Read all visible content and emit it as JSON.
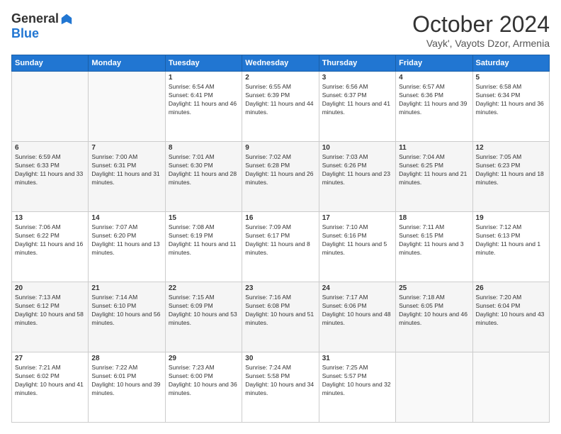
{
  "header": {
    "logo_general": "General",
    "logo_blue": "Blue",
    "month_title": "October 2024",
    "subtitle": "Vayk', Vayots Dzor, Armenia"
  },
  "days_of_week": [
    "Sunday",
    "Monday",
    "Tuesday",
    "Wednesday",
    "Thursday",
    "Friday",
    "Saturday"
  ],
  "weeks": [
    [
      {
        "day": "",
        "sunrise": "",
        "sunset": "",
        "daylight": "",
        "empty": true
      },
      {
        "day": "",
        "sunrise": "",
        "sunset": "",
        "daylight": "",
        "empty": true
      },
      {
        "day": "1",
        "sunrise": "Sunrise: 6:54 AM",
        "sunset": "Sunset: 6:41 PM",
        "daylight": "Daylight: 11 hours and 46 minutes."
      },
      {
        "day": "2",
        "sunrise": "Sunrise: 6:55 AM",
        "sunset": "Sunset: 6:39 PM",
        "daylight": "Daylight: 11 hours and 44 minutes."
      },
      {
        "day": "3",
        "sunrise": "Sunrise: 6:56 AM",
        "sunset": "Sunset: 6:37 PM",
        "daylight": "Daylight: 11 hours and 41 minutes."
      },
      {
        "day": "4",
        "sunrise": "Sunrise: 6:57 AM",
        "sunset": "Sunset: 6:36 PM",
        "daylight": "Daylight: 11 hours and 39 minutes."
      },
      {
        "day": "5",
        "sunrise": "Sunrise: 6:58 AM",
        "sunset": "Sunset: 6:34 PM",
        "daylight": "Daylight: 11 hours and 36 minutes."
      }
    ],
    [
      {
        "day": "6",
        "sunrise": "Sunrise: 6:59 AM",
        "sunset": "Sunset: 6:33 PM",
        "daylight": "Daylight: 11 hours and 33 minutes."
      },
      {
        "day": "7",
        "sunrise": "Sunrise: 7:00 AM",
        "sunset": "Sunset: 6:31 PM",
        "daylight": "Daylight: 11 hours and 31 minutes."
      },
      {
        "day": "8",
        "sunrise": "Sunrise: 7:01 AM",
        "sunset": "Sunset: 6:30 PM",
        "daylight": "Daylight: 11 hours and 28 minutes."
      },
      {
        "day": "9",
        "sunrise": "Sunrise: 7:02 AM",
        "sunset": "Sunset: 6:28 PM",
        "daylight": "Daylight: 11 hours and 26 minutes."
      },
      {
        "day": "10",
        "sunrise": "Sunrise: 7:03 AM",
        "sunset": "Sunset: 6:26 PM",
        "daylight": "Daylight: 11 hours and 23 minutes."
      },
      {
        "day": "11",
        "sunrise": "Sunrise: 7:04 AM",
        "sunset": "Sunset: 6:25 PM",
        "daylight": "Daylight: 11 hours and 21 minutes."
      },
      {
        "day": "12",
        "sunrise": "Sunrise: 7:05 AM",
        "sunset": "Sunset: 6:23 PM",
        "daylight": "Daylight: 11 hours and 18 minutes."
      }
    ],
    [
      {
        "day": "13",
        "sunrise": "Sunrise: 7:06 AM",
        "sunset": "Sunset: 6:22 PM",
        "daylight": "Daylight: 11 hours and 16 minutes."
      },
      {
        "day": "14",
        "sunrise": "Sunrise: 7:07 AM",
        "sunset": "Sunset: 6:20 PM",
        "daylight": "Daylight: 11 hours and 13 minutes."
      },
      {
        "day": "15",
        "sunrise": "Sunrise: 7:08 AM",
        "sunset": "Sunset: 6:19 PM",
        "daylight": "Daylight: 11 hours and 11 minutes."
      },
      {
        "day": "16",
        "sunrise": "Sunrise: 7:09 AM",
        "sunset": "Sunset: 6:17 PM",
        "daylight": "Daylight: 11 hours and 8 minutes."
      },
      {
        "day": "17",
        "sunrise": "Sunrise: 7:10 AM",
        "sunset": "Sunset: 6:16 PM",
        "daylight": "Daylight: 11 hours and 5 minutes."
      },
      {
        "day": "18",
        "sunrise": "Sunrise: 7:11 AM",
        "sunset": "Sunset: 6:15 PM",
        "daylight": "Daylight: 11 hours and 3 minutes."
      },
      {
        "day": "19",
        "sunrise": "Sunrise: 7:12 AM",
        "sunset": "Sunset: 6:13 PM",
        "daylight": "Daylight: 11 hours and 1 minute."
      }
    ],
    [
      {
        "day": "20",
        "sunrise": "Sunrise: 7:13 AM",
        "sunset": "Sunset: 6:12 PM",
        "daylight": "Daylight: 10 hours and 58 minutes."
      },
      {
        "day": "21",
        "sunrise": "Sunrise: 7:14 AM",
        "sunset": "Sunset: 6:10 PM",
        "daylight": "Daylight: 10 hours and 56 minutes."
      },
      {
        "day": "22",
        "sunrise": "Sunrise: 7:15 AM",
        "sunset": "Sunset: 6:09 PM",
        "daylight": "Daylight: 10 hours and 53 minutes."
      },
      {
        "day": "23",
        "sunrise": "Sunrise: 7:16 AM",
        "sunset": "Sunset: 6:08 PM",
        "daylight": "Daylight: 10 hours and 51 minutes."
      },
      {
        "day": "24",
        "sunrise": "Sunrise: 7:17 AM",
        "sunset": "Sunset: 6:06 PM",
        "daylight": "Daylight: 10 hours and 48 minutes."
      },
      {
        "day": "25",
        "sunrise": "Sunrise: 7:18 AM",
        "sunset": "Sunset: 6:05 PM",
        "daylight": "Daylight: 10 hours and 46 minutes."
      },
      {
        "day": "26",
        "sunrise": "Sunrise: 7:20 AM",
        "sunset": "Sunset: 6:04 PM",
        "daylight": "Daylight: 10 hours and 43 minutes."
      }
    ],
    [
      {
        "day": "27",
        "sunrise": "Sunrise: 7:21 AM",
        "sunset": "Sunset: 6:02 PM",
        "daylight": "Daylight: 10 hours and 41 minutes."
      },
      {
        "day": "28",
        "sunrise": "Sunrise: 7:22 AM",
        "sunset": "Sunset: 6:01 PM",
        "daylight": "Daylight: 10 hours and 39 minutes."
      },
      {
        "day": "29",
        "sunrise": "Sunrise: 7:23 AM",
        "sunset": "Sunset: 6:00 PM",
        "daylight": "Daylight: 10 hours and 36 minutes."
      },
      {
        "day": "30",
        "sunrise": "Sunrise: 7:24 AM",
        "sunset": "Sunset: 5:58 PM",
        "daylight": "Daylight: 10 hours and 34 minutes."
      },
      {
        "day": "31",
        "sunrise": "Sunrise: 7:25 AM",
        "sunset": "Sunset: 5:57 PM",
        "daylight": "Daylight: 10 hours and 32 minutes."
      },
      {
        "day": "",
        "sunrise": "",
        "sunset": "",
        "daylight": "",
        "empty": true
      },
      {
        "day": "",
        "sunrise": "",
        "sunset": "",
        "daylight": "",
        "empty": true
      }
    ]
  ]
}
